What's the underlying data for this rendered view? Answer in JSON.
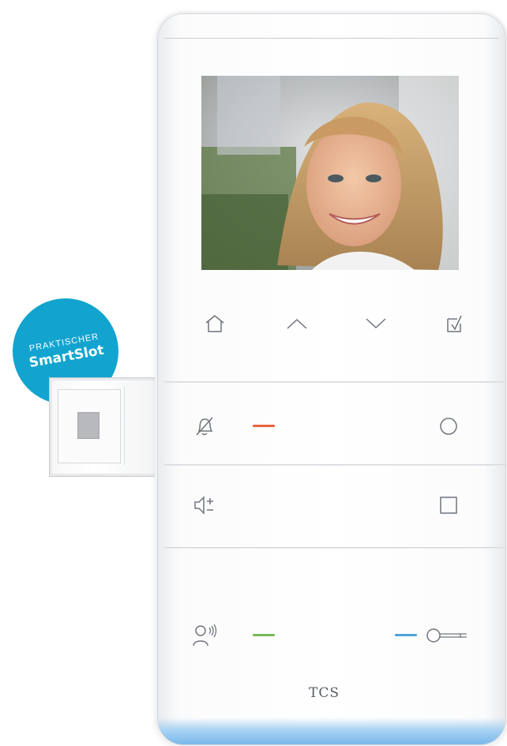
{
  "badge": {
    "line1": "PRAKTISCHER",
    "line2": "SmartSlot",
    "color": "#12a4cf"
  },
  "brand": {
    "logo_text": "TCS"
  },
  "icons": {
    "home": "home-icon",
    "up": "chevron-up-icon",
    "down": "chevron-down-icon",
    "menu_check": "checkbox-icon",
    "mute": "bell-off-icon",
    "function_circle": "circle-icon",
    "volume": "volume-plus-minus-icon",
    "function_square": "square-icon",
    "talk": "person-talk-icon",
    "door_key": "key-icon"
  },
  "indicators": {
    "mute_color": "#e8623f",
    "talk_color": "#7ab857",
    "door_color": "#4da3dc"
  }
}
